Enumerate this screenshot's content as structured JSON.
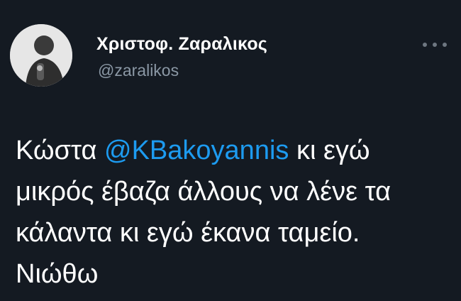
{
  "tweet": {
    "author_name": "Χριστοφ. Ζαραλικος",
    "author_handle": "@zaralikos",
    "avatar_icon": "profile-photo-icon",
    "more_icon": "more-options-icon",
    "body_line1_prefix": "Κώστα ",
    "body_mention": "@KBakoyannis",
    "body_line1_suffix": " κι εγώ",
    "body_line2": "μικρός έβαζα άλλους να λένε τα",
    "body_line3": "κάλαντα κι εγώ έκανα ταμείο.",
    "body_line4": "Νιώθω"
  },
  "colors": {
    "background": "#141a22",
    "text": "#ffffff",
    "handle": "#8b98a5",
    "mention": "#1d9bf0"
  }
}
